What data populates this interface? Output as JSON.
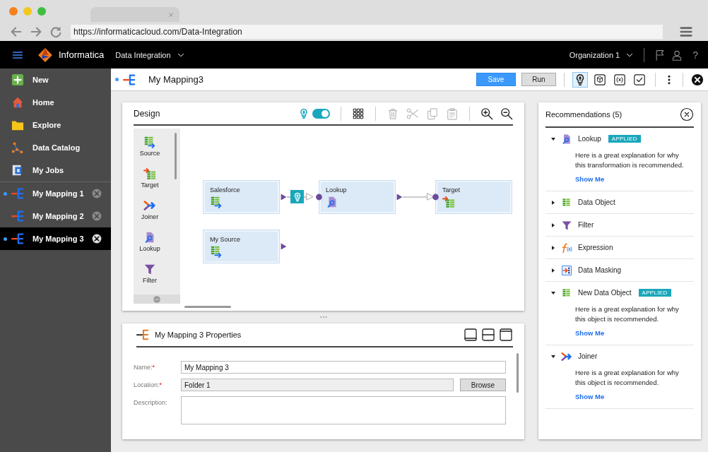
{
  "browser": {
    "url": "https://informaticacloud.com/Data-Integration"
  },
  "header": {
    "product": "Informatica",
    "app": "Data Integration",
    "org": "Organization 1",
    "help": "?"
  },
  "sidebar": {
    "items": [
      {
        "kind": "new",
        "label": "New"
      },
      {
        "kind": "home",
        "label": "Home"
      },
      {
        "kind": "folder",
        "label": "Explore"
      },
      {
        "kind": "catalog",
        "label": "Data Catalog"
      },
      {
        "kind": "jobs",
        "label": "My Jobs"
      },
      {
        "kind": "mapping",
        "label": "My Mapping 1",
        "modified": true,
        "selected": false
      },
      {
        "kind": "mapping",
        "label": "My Mapping 2",
        "modified": false,
        "selected": false
      },
      {
        "kind": "mapping",
        "label": "My Mapping 3",
        "modified": true,
        "selected": true
      }
    ]
  },
  "toolbar": {
    "title": "My Mapping3",
    "modified": true,
    "save": "Save",
    "run": "Run",
    "tools": [
      {
        "kind": "bulb",
        "selected": true
      },
      {
        "kind": "cube",
        "selected": false
      },
      {
        "kind": "fxbox",
        "selected": false
      },
      {
        "kind": "checkbox",
        "selected": false
      }
    ]
  },
  "design": {
    "title": "Design",
    "recommendations_on": true,
    "palette": [
      {
        "kind": "source",
        "label": "Source"
      },
      {
        "kind": "target",
        "label": "Target"
      },
      {
        "kind": "joiner",
        "label": "Joiner"
      },
      {
        "kind": "lookup",
        "label": "Lookup"
      },
      {
        "kind": "filter",
        "label": "Filter"
      }
    ],
    "nodes": [
      {
        "kind": "source",
        "label": "Salesforce",
        "input": false,
        "output": true
      },
      {
        "kind": "lookup",
        "label": "Lookup",
        "input": true,
        "output": true
      },
      {
        "kind": "target",
        "label": "Target",
        "input": true,
        "output": false
      },
      {
        "kind": "source",
        "label": "My Source",
        "input": false,
        "output": true
      }
    ]
  },
  "recommendations": {
    "title": "Recommendations (5)",
    "items": [
      {
        "kind": "lookup",
        "label": "Lookup",
        "expanded": true,
        "badge": "APPLIED",
        "description": "Here is a great explanation for why this transformation is recommended.",
        "link": "Show Me"
      },
      {
        "kind": "table",
        "label": "Data Object",
        "expanded": false
      },
      {
        "kind": "filter",
        "label": "Filter",
        "expanded": false
      },
      {
        "kind": "expression",
        "label": "Expression",
        "expanded": false
      },
      {
        "kind": "masking",
        "label": "Data Masking",
        "expanded": false
      },
      {
        "kind": "table",
        "label": "New Data Object",
        "expanded": true,
        "badge": "APPLIED",
        "description": "Here is a great explanation for why this object is recommended.",
        "link": "Show Me"
      },
      {
        "kind": "joiner",
        "label": "Joiner",
        "expanded": true,
        "description": "Here is a great explanation for why this object is recommended.",
        "link": "Show Me"
      }
    ]
  },
  "properties": {
    "title": "My Mapping 3 Properties",
    "fields": [
      {
        "kind": "text",
        "label": "Name:",
        "required_mark": "*",
        "value": "My Mapping 3"
      },
      {
        "kind": "readonly",
        "label": "Location:",
        "required_mark": "*",
        "value": "Folder 1",
        "button": "Browse"
      },
      {
        "kind": "textarea",
        "label": "Description:"
      }
    ]
  }
}
